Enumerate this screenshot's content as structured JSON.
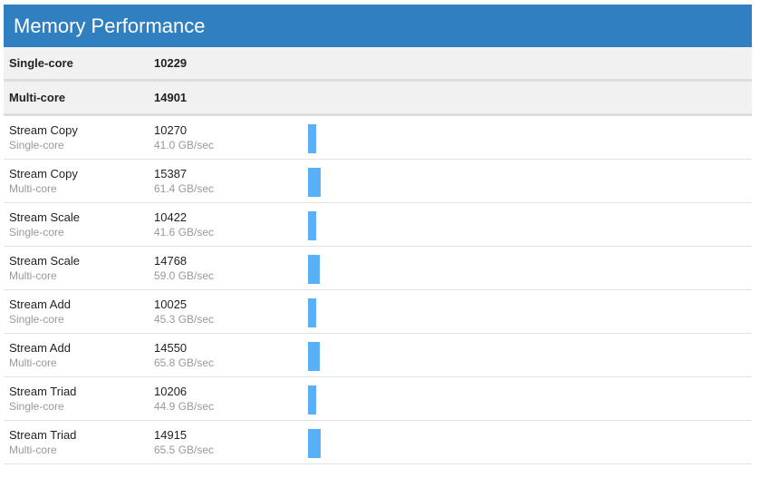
{
  "header": {
    "title": "Memory Performance"
  },
  "summary": [
    {
      "label": "Single-core",
      "score": "10229"
    },
    {
      "label": "Multi-core",
      "score": "14901"
    }
  ],
  "rows": [
    {
      "name": "Stream Copy",
      "mode": "Single-core",
      "score": "10270",
      "rate": "41.0 GB/sec",
      "score_value": 10270
    },
    {
      "name": "Stream Copy",
      "mode": "Multi-core",
      "score": "15387",
      "rate": "61.4 GB/sec",
      "score_value": 15387
    },
    {
      "name": "Stream Scale",
      "mode": "Single-core",
      "score": "10422",
      "rate": "41.6 GB/sec",
      "score_value": 10422
    },
    {
      "name": "Stream Scale",
      "mode": "Multi-core",
      "score": "14768",
      "rate": "59.0 GB/sec",
      "score_value": 14768
    },
    {
      "name": "Stream Add",
      "mode": "Single-core",
      "score": "10025",
      "rate": "45.3 GB/sec",
      "score_value": 10025
    },
    {
      "name": "Stream Add",
      "mode": "Multi-core",
      "score": "14550",
      "rate": "65.8 GB/sec",
      "score_value": 14550
    },
    {
      "name": "Stream Triad",
      "mode": "Single-core",
      "score": "10206",
      "rate": "44.9 GB/sec",
      "score_value": 10206
    },
    {
      "name": "Stream Triad",
      "mode": "Multi-core",
      "score": "14915",
      "rate": "65.5 GB/sec",
      "score_value": 14915
    }
  ],
  "colors": {
    "header": "#2f7fc1",
    "bar": "#5ab0f6",
    "summary_bg": "#f1f1f1"
  }
}
